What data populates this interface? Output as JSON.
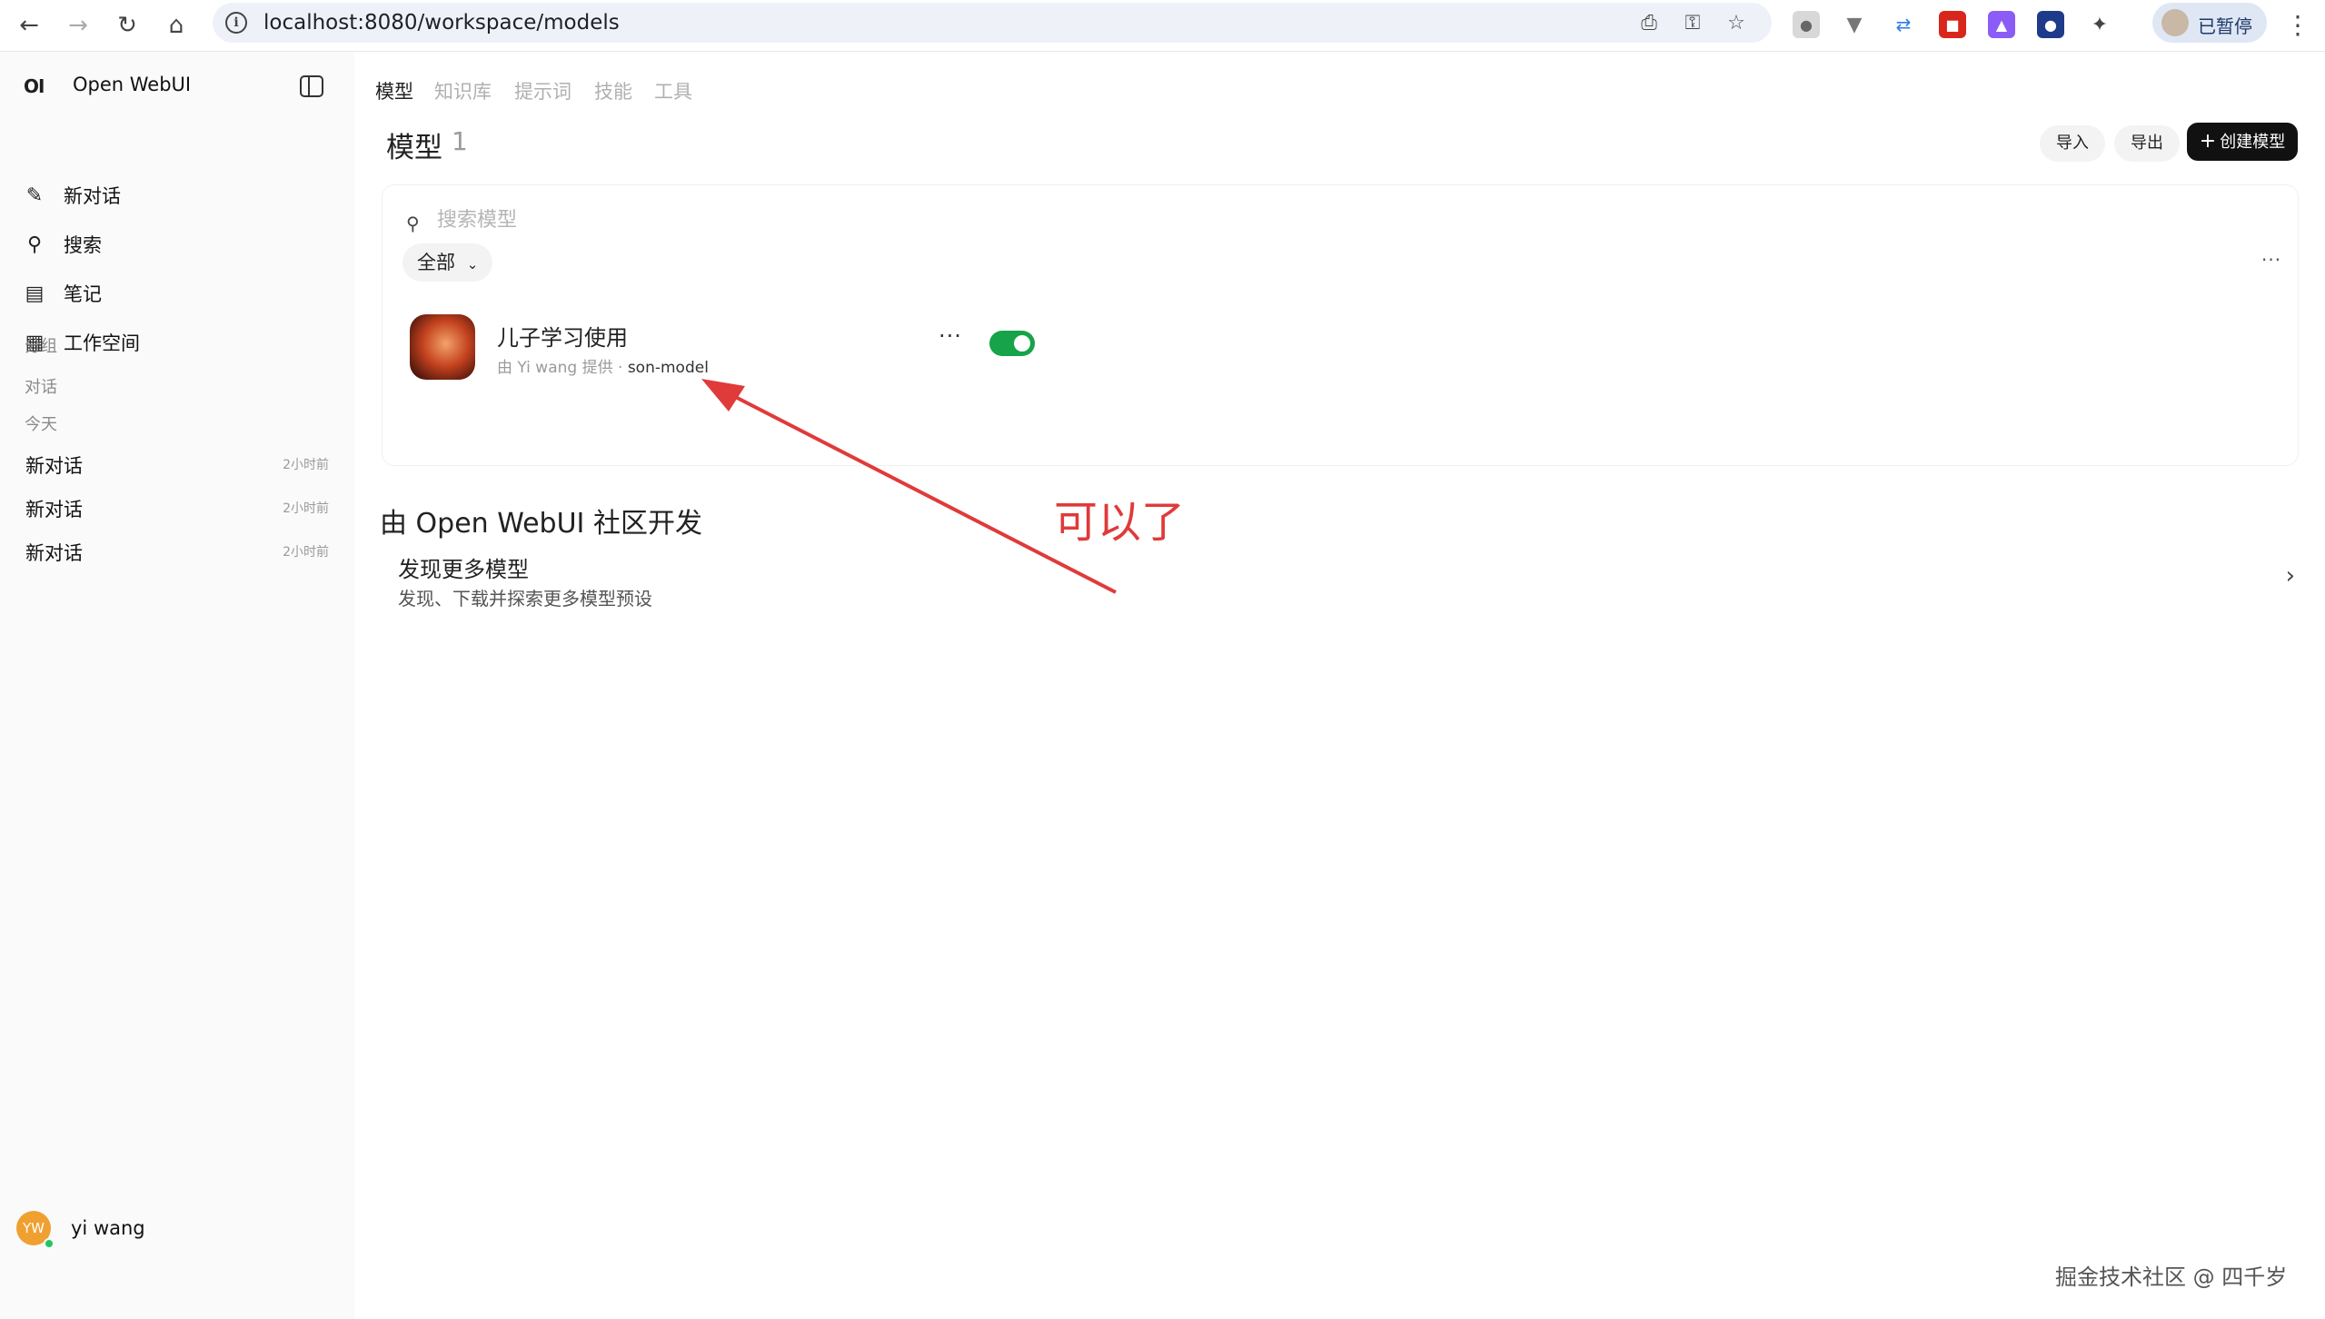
{
  "browser": {
    "url": "localhost:8080/workspace/models",
    "profile_label": "已暂停"
  },
  "sidebar": {
    "brand_logo": "OI",
    "brand_name": "Open WebUI",
    "items": [
      {
        "label": "新对话",
        "icon": "edit-icon"
      },
      {
        "label": "搜索",
        "icon": "search-icon"
      },
      {
        "label": "笔记",
        "icon": "notes-icon"
      },
      {
        "label": "工作空间",
        "icon": "workspace-icon"
      }
    ],
    "groups_heading": "分组",
    "chats_heading": "对话",
    "today_heading": "今天",
    "chats": [
      {
        "title": "新对话",
        "time": "2小时前"
      },
      {
        "title": "新对话",
        "time": "2小时前"
      },
      {
        "title": "新对话",
        "time": "2小时前"
      }
    ],
    "user": {
      "initials": "YW",
      "name": "yi wang"
    }
  },
  "main": {
    "tabs": [
      {
        "label": "模型",
        "active": true
      },
      {
        "label": "知识库",
        "active": false
      },
      {
        "label": "提示词",
        "active": false
      },
      {
        "label": "技能",
        "active": false
      },
      {
        "label": "工具",
        "active": false
      }
    ],
    "title": "模型",
    "count": "1",
    "import_label": "导入",
    "export_label": "导出",
    "create_label": "创建模型",
    "search_placeholder": "搜索模型",
    "filter_label": "全部",
    "more_label": "···",
    "models": [
      {
        "name": "儿子学习使用",
        "provider": "由 Yi wang 提供",
        "id": "son-model",
        "enabled": true
      }
    ],
    "community_title": "由 Open WebUI 社区开发",
    "discover_title": "发现更多模型",
    "discover_sub": "发现、下载并探索更多模型预设"
  },
  "annotation": {
    "text": "可以了",
    "color": "#e03a3a"
  },
  "watermark": "掘金技术社区 @ 四千岁",
  "colors": {
    "toggle_on": "#16a34a",
    "primary_button": "#111111",
    "sidebar_bg": "#fafafa"
  }
}
